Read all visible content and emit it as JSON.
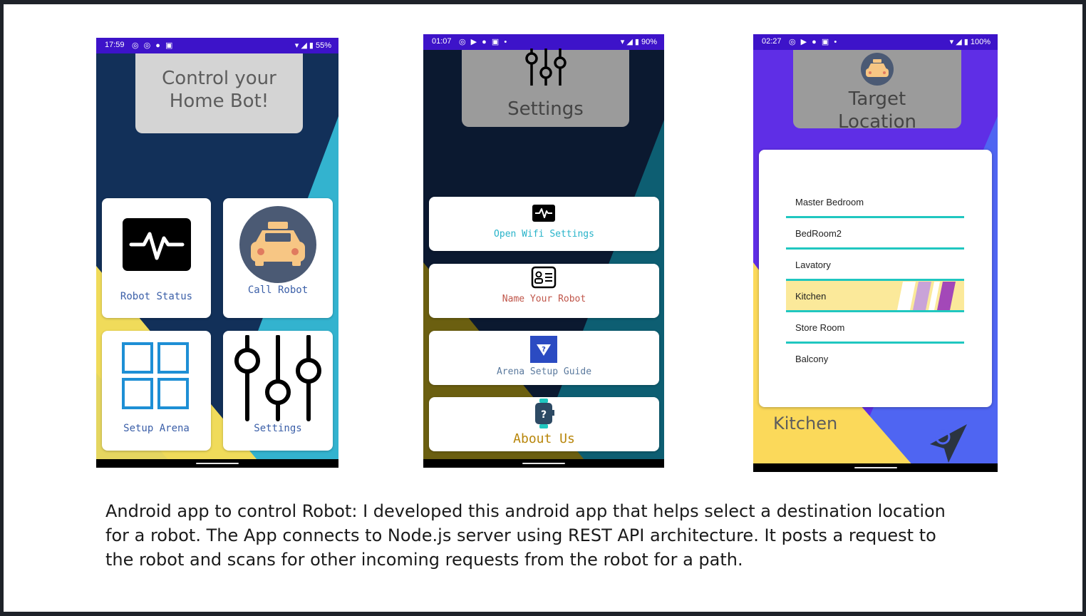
{
  "phones": {
    "home": {
      "status": {
        "time": "17:59",
        "battery": "55%"
      },
      "title_line1": "Control your",
      "title_line2": "Home Bot!",
      "tiles": [
        {
          "label": "Robot Status"
        },
        {
          "label": "Call Robot"
        },
        {
          "label": "Setup Arena"
        },
        {
          "label": "Settings"
        }
      ]
    },
    "settings": {
      "status": {
        "time": "01:07",
        "battery": "90%"
      },
      "title": "Settings",
      "items": [
        {
          "label": "Open Wifi Settings",
          "color": "#27b3c9"
        },
        {
          "label": "Name Your Robot",
          "color": "#c0564a"
        },
        {
          "label": "Arena Setup Guide",
          "color": "#5b7a9e"
        },
        {
          "label": "About Us",
          "color": "#b8860b"
        }
      ]
    },
    "target": {
      "status": {
        "time": "02:27",
        "battery": "100%"
      },
      "title_line1": "Target",
      "title_line2": "Location",
      "locations": [
        "Master Bedroom",
        "BedRoom2",
        "Lavatory",
        "Kitchen",
        "Store Room",
        "Balcony"
      ],
      "selected_location": "Kitchen",
      "current_label": "Kitchen"
    }
  },
  "caption": {
    "line1": "Android app to control Robot: I developed this android app that helps select a destination location",
    "line2": "for a robot. The App connects to Node.js server using REST API architecture. It posts a request to",
    "line3": "the robot and scans for other incoming requests from the robot for a path."
  },
  "colors": {
    "home_bg": "#123059",
    "home_accent": "#33b3cf",
    "home_yellow": "#f0db5a",
    "settings_bg": "#0b1930",
    "settings_teal": "#0d5e72",
    "settings_olive": "#6b5f10",
    "target_purple": "#5f2ee6",
    "target_blue": "#4f65f2",
    "target_yellow": "#fbd95a",
    "status_bar": "#3d13c9",
    "line_teal": "#20c7c0"
  }
}
